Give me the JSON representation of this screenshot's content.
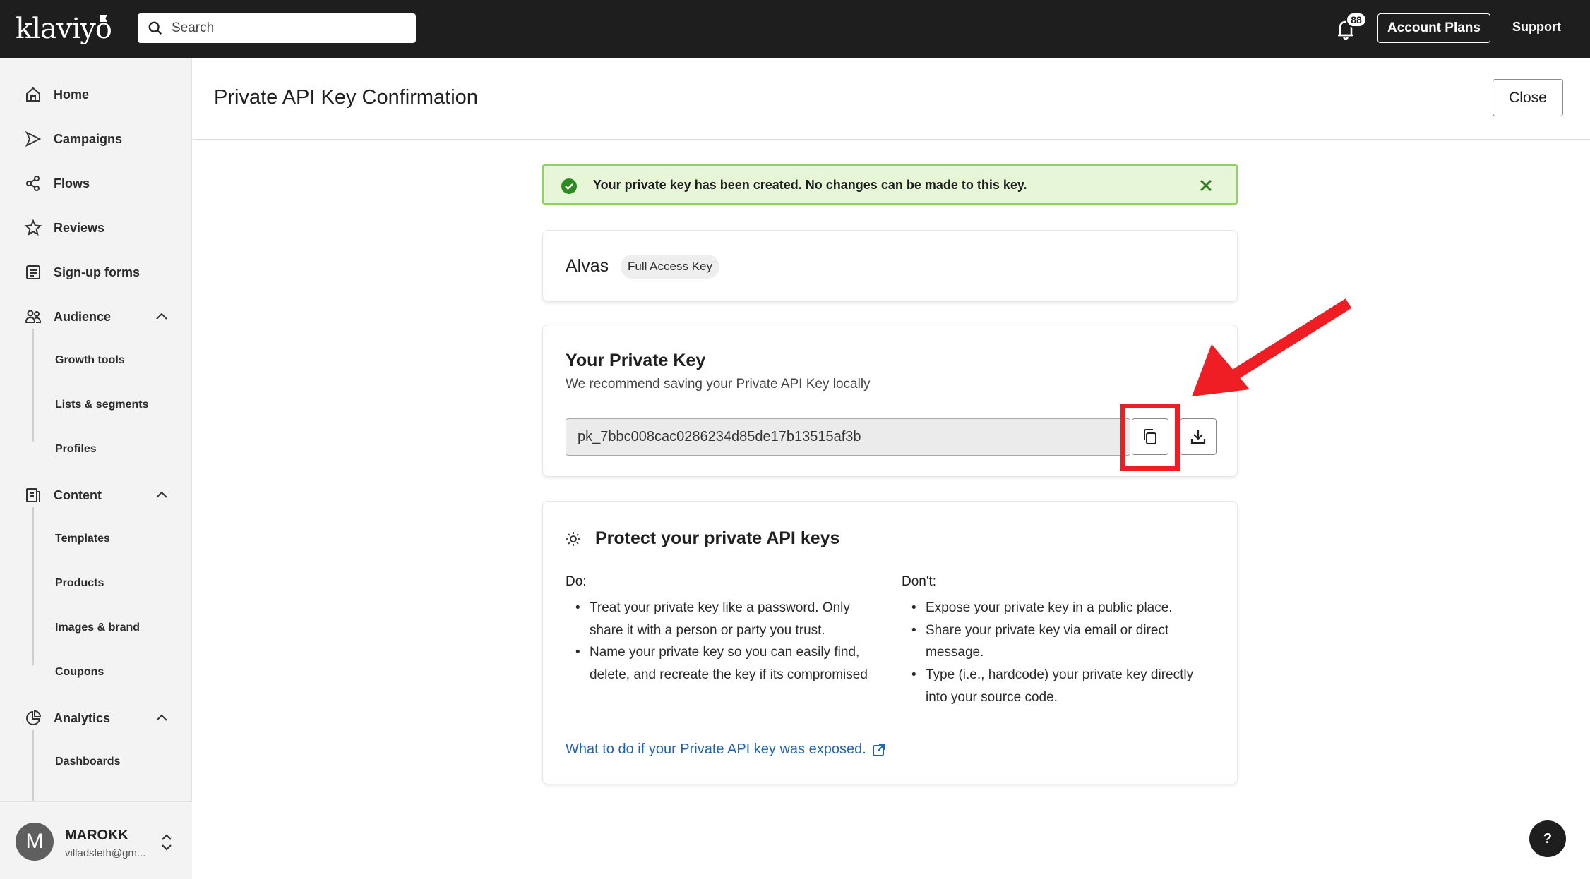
{
  "header": {
    "logo": "klaviyo",
    "search_placeholder": "Search",
    "notification_count": "88",
    "account_plans": "Account Plans",
    "support": "Support"
  },
  "sidebar": {
    "items": [
      {
        "label": "Home",
        "icon": "home-icon"
      },
      {
        "label": "Campaigns",
        "icon": "send-icon"
      },
      {
        "label": "Flows",
        "icon": "flows-icon"
      },
      {
        "label": "Reviews",
        "icon": "star-icon"
      },
      {
        "label": "Sign-up forms",
        "icon": "form-icon"
      },
      {
        "label": "Audience",
        "icon": "people-icon"
      },
      {
        "label": "Content",
        "icon": "content-icon"
      },
      {
        "label": "Analytics",
        "icon": "chart-icon"
      }
    ],
    "audience_sub": [
      "Growth tools",
      "Lists & segments",
      "Profiles"
    ],
    "content_sub": [
      "Templates",
      "Products",
      "Images & brand",
      "Coupons"
    ],
    "analytics_sub": [
      "Dashboards"
    ],
    "profile": {
      "initial": "M",
      "name": "MAROKK",
      "email": "villadsleth@gm..."
    }
  },
  "page": {
    "title": "Private API Key Confirmation",
    "close_label": "Close",
    "alert": "Your private key has been created. No changes can be made to this key.",
    "key_card": {
      "name": "Alvas",
      "badge": "Full Access Key"
    },
    "private_key": {
      "title": "Your Private Key",
      "subtitle": "We recommend saving your Private API Key locally",
      "value": "pk_7bbc008cac0286234d85de17b13515af3b"
    },
    "protect": {
      "title": "Protect your private API keys",
      "do_label": "Do:",
      "do_items": [
        "Treat your private key like a password. Only share it with a person or party you trust.",
        "Name your private key so you can easily find, delete, and recreate the key if its compromised"
      ],
      "dont_label": "Don't:",
      "dont_items": [
        "Expose your private key in a public place.",
        "Share your private key via email or direct message.",
        "Type (i.e., hardcode) your private key directly into your source code."
      ],
      "link": "What to do if your Private API key was exposed."
    }
  },
  "help_label": "?",
  "colors": {
    "topbar": "#1e1e1e",
    "alert_bg": "#e8f6d8",
    "alert_border": "#8fd45a",
    "highlight": "#ee1e24",
    "link": "#2563a8"
  }
}
